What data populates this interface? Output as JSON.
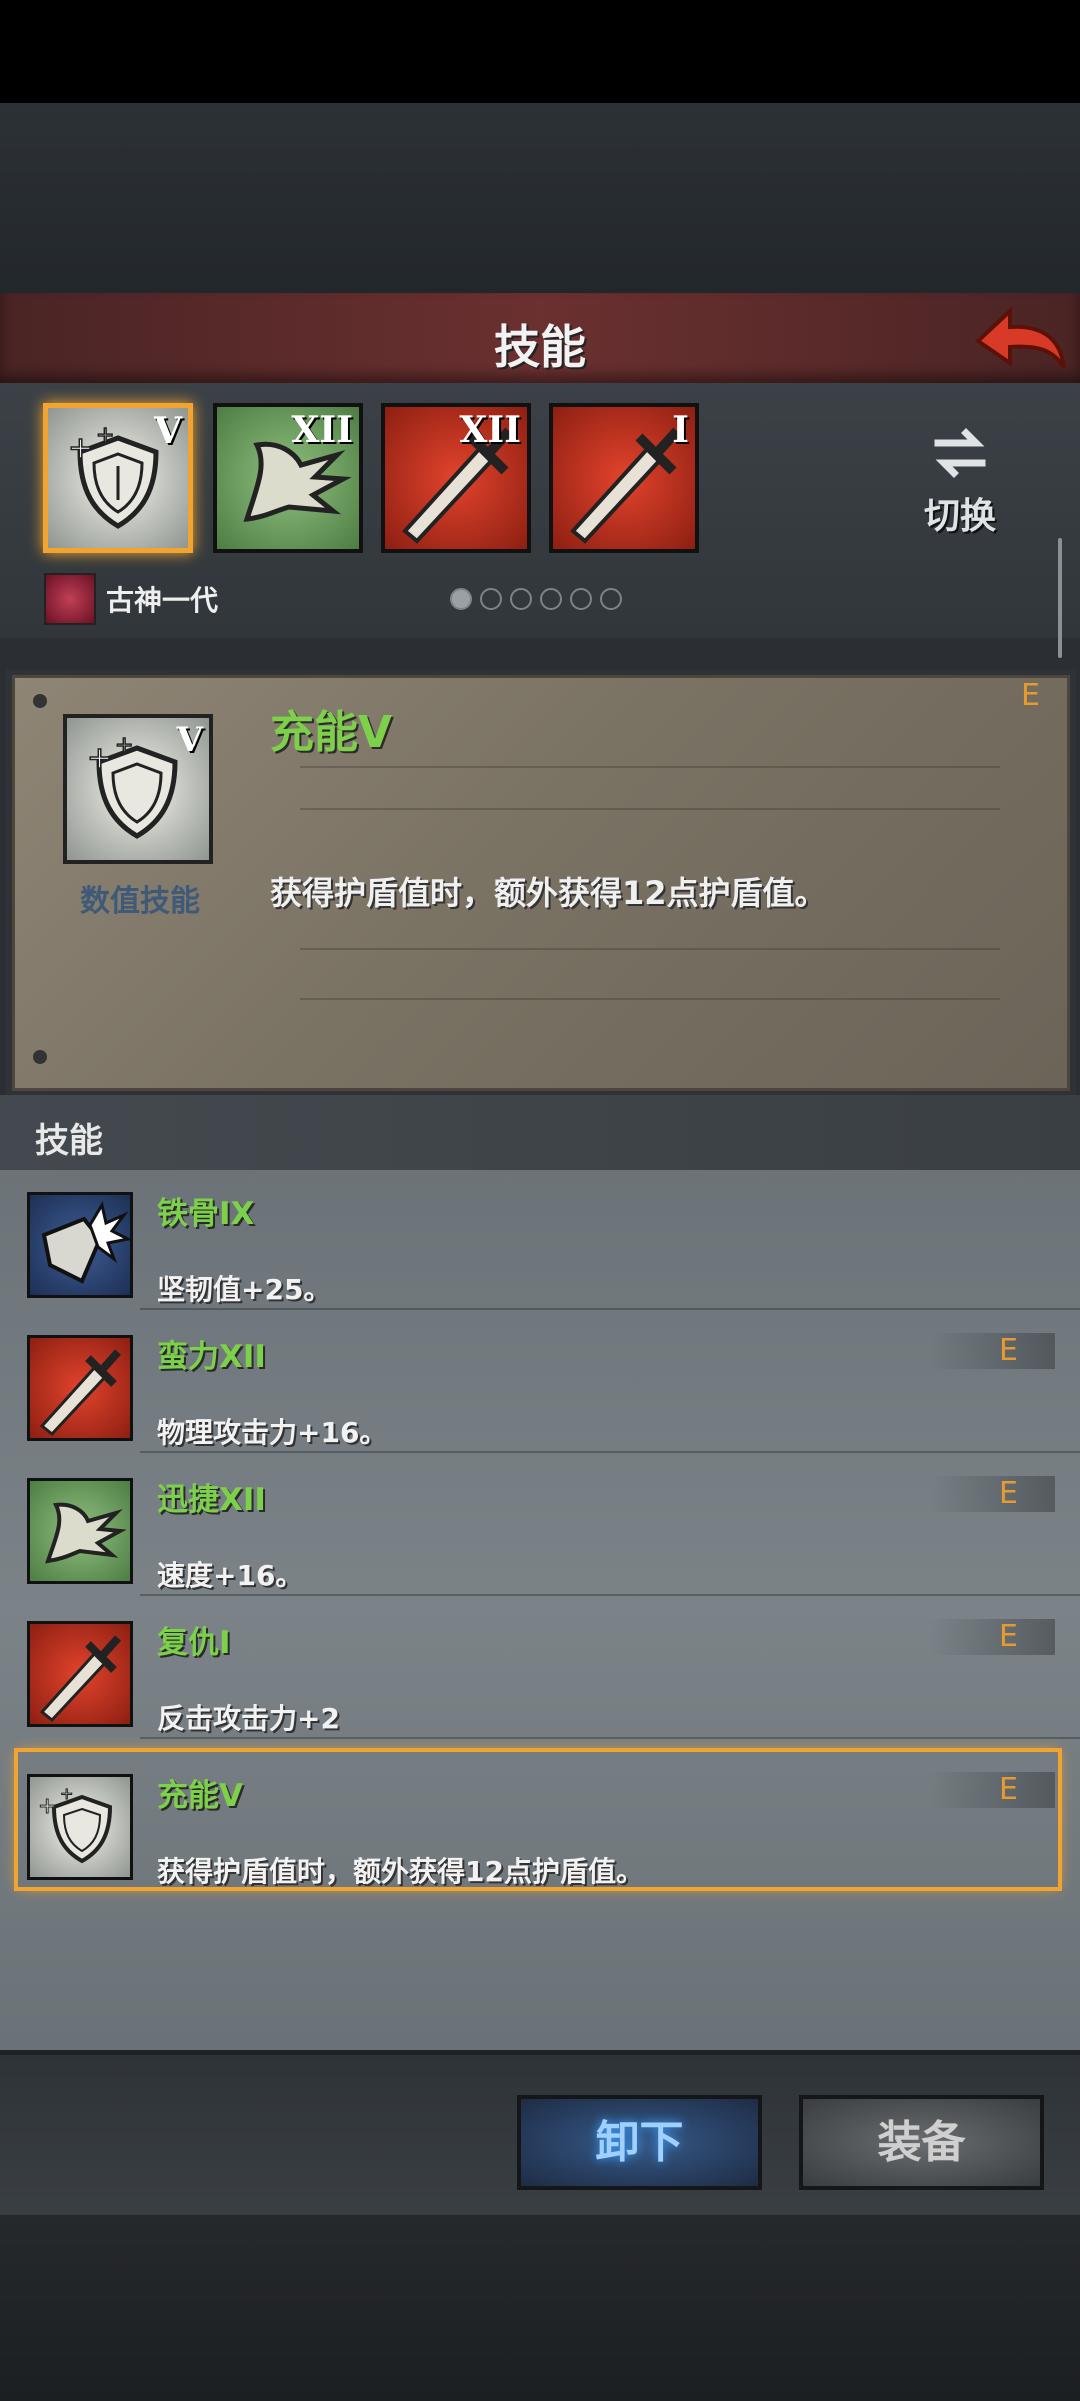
{
  "title": "技能",
  "skill_slots": [
    {
      "rank": "V",
      "icon": "shield-charge-icon",
      "bg": "white",
      "selected": true
    },
    {
      "rank": "XII",
      "icon": "swift-wing-icon",
      "bg": "green",
      "selected": false
    },
    {
      "rank": "XII",
      "icon": "sword-icon",
      "bg": "red",
      "selected": false
    },
    {
      "rank": "I",
      "icon": "sword-icon",
      "bg": "red",
      "selected": false
    }
  ],
  "switch_label": "切换",
  "owner_name": "古神一代",
  "page_dots": {
    "total": 6,
    "active": 1
  },
  "detail": {
    "name": "充能V",
    "rank": "V",
    "type_label": "数值技能",
    "description": "获得护盾值时，额外获得12点护盾值。",
    "tag": "E"
  },
  "section_title": "技能",
  "skills": [
    {
      "name": "铁骨IX",
      "description": "坚韧值+25。",
      "icon": "iron-bone-icon",
      "tag": ""
    },
    {
      "name": "蛮力XII",
      "description": "物理攻击力+16。",
      "icon": "sword-icon",
      "tag": "E"
    },
    {
      "name": "迅捷XII",
      "description": "速度+16。",
      "icon": "swift-wing-icon",
      "tag": "E"
    },
    {
      "name": "复仇I",
      "description": "反击攻击力+2",
      "icon": "sword-icon",
      "tag": "E"
    },
    {
      "name": "充能V",
      "description": "获得护盾值时，额外获得12点护盾值。",
      "icon": "shield-charge-icon",
      "tag": "E"
    }
  ],
  "buttons": {
    "unequip": "卸下",
    "equip": "装备"
  },
  "colors": {
    "skill_name": "#7cd04a",
    "tag": "#e69a2f",
    "selection": "#f2a431"
  }
}
